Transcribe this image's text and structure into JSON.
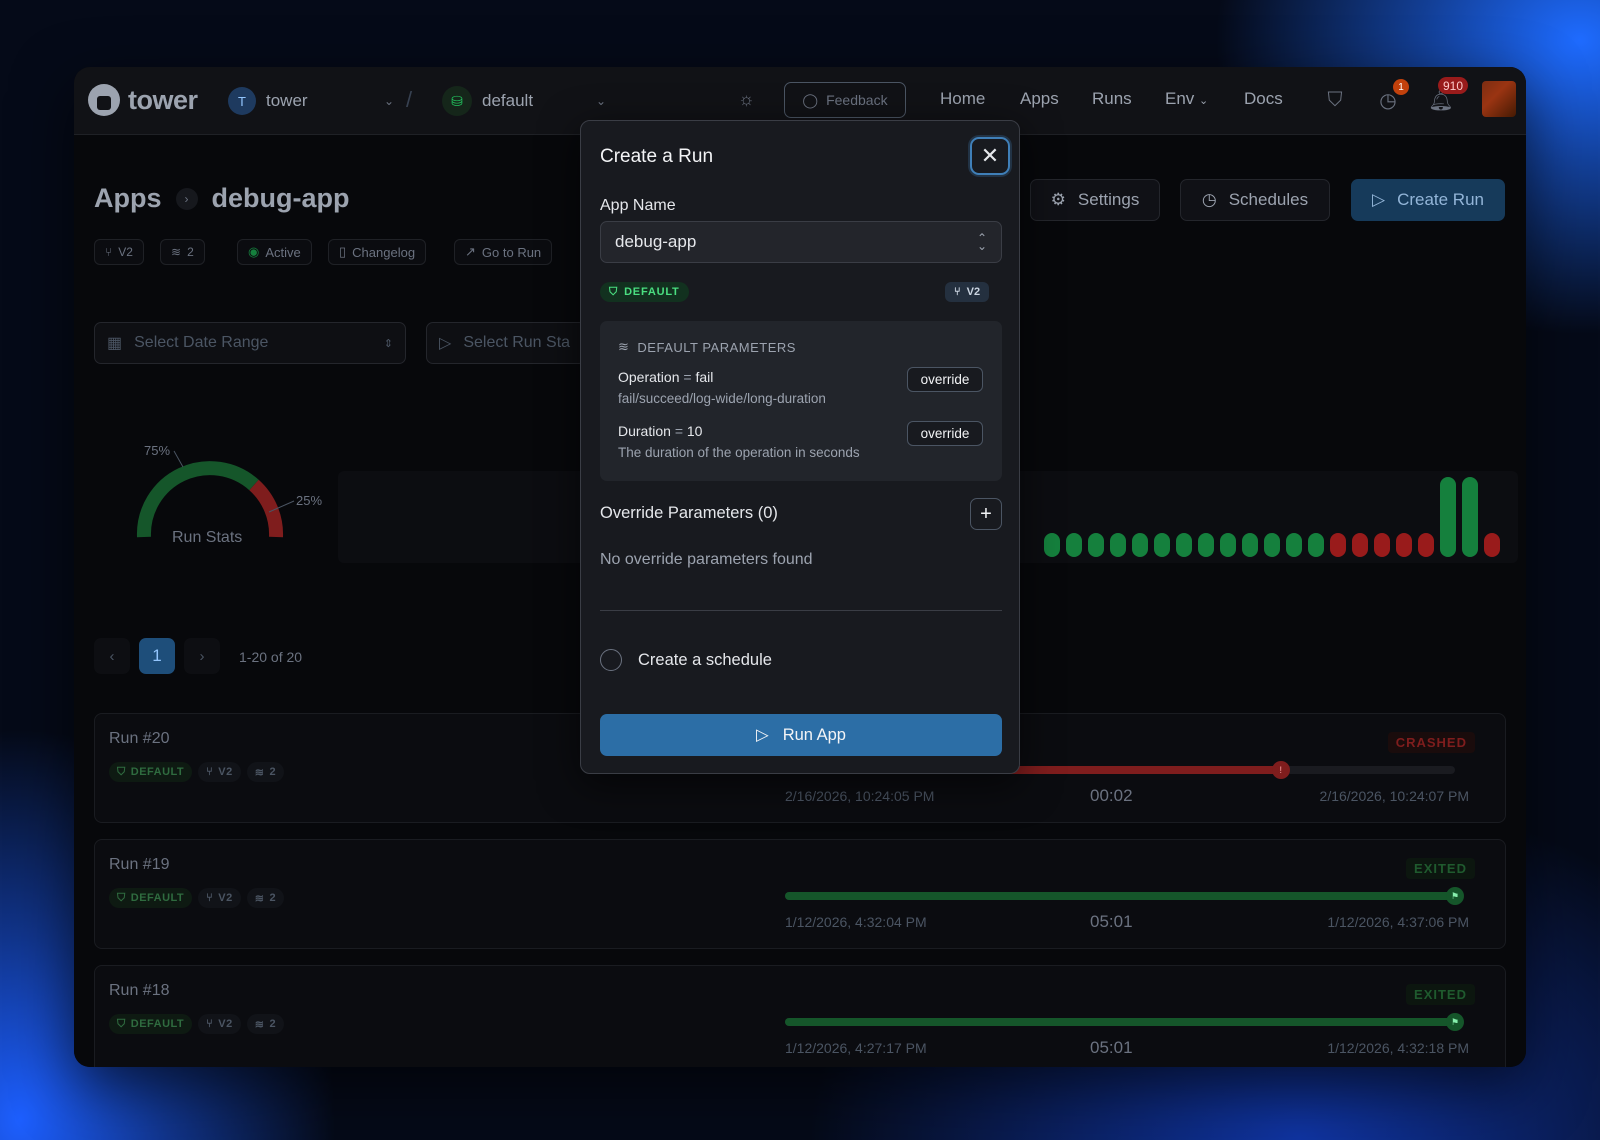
{
  "brand": {
    "name": "tower"
  },
  "team": {
    "initial": "T",
    "name": "tower"
  },
  "environment": {
    "name": "default"
  },
  "topbar": {
    "feedback_label": "Feedback",
    "nav": [
      "Home",
      "Apps",
      "Runs",
      "Env",
      "Docs"
    ],
    "alerts_badge": "1",
    "notifications_count": "910"
  },
  "breadcrumb": {
    "root": "Apps",
    "current": "debug-app"
  },
  "app_meta": {
    "version": "V2",
    "param_count": "2",
    "status": "Active",
    "changelog": "Changelog",
    "go_to_run": "Go to Run"
  },
  "header_actions": {
    "settings": "Settings",
    "schedules": "Schedules",
    "create_run": "Create Run"
  },
  "filters": {
    "date_range_placeholder": "Select Date Range",
    "run_status_placeholder": "Select Run Sta"
  },
  "stats": {
    "gauge_label": "Run Stats",
    "success_pct_label": "75%",
    "fail_pct_label": "25%",
    "success_fraction": 0.75,
    "recent_runs": [
      "success",
      "success",
      "success",
      "success",
      "success",
      "success",
      "success",
      "success",
      "success",
      "success",
      "success",
      "success",
      "success",
      "failed",
      "failed",
      "failed",
      "failed",
      "failed",
      "success-long",
      "success-long",
      "failed"
    ],
    "colors": {
      "success": "#15803d",
      "failed": "#991b1b"
    }
  },
  "pagination": {
    "current_page": "1",
    "range": "1-20 of 20"
  },
  "runs": [
    {
      "title": "Run #20",
      "env": "DEFAULT",
      "version": "V2",
      "params": "2",
      "status": "CRASHED",
      "start": "2/16/2026, 10:24:05 PM",
      "duration": "00:02",
      "end": "2/16/2026, 10:24:07 PM",
      "progress": 0.74
    },
    {
      "title": "Run #19",
      "env": "DEFAULT",
      "version": "V2",
      "params": "2",
      "status": "EXITED",
      "start": "1/12/2026, 4:32:04 PM",
      "duration": "05:01",
      "end": "1/12/2026, 4:37:06 PM",
      "progress": 1.0
    },
    {
      "title": "Run #18",
      "env": "DEFAULT",
      "version": "V2",
      "params": "2",
      "status": "EXITED",
      "start": "1/12/2026, 4:27:17 PM",
      "duration": "05:01",
      "end": "1/12/2026, 4:32:18 PM",
      "progress": 1.0
    }
  ],
  "modal": {
    "title": "Create a Run",
    "app_name_label": "App Name",
    "app_name_value": "debug-app",
    "env_badge": "DEFAULT",
    "version_badge": "V2",
    "default_params_heading": "DEFAULT PARAMETERS",
    "params": [
      {
        "name": "Operation",
        "value": "fail",
        "description": "fail/succeed/log-wide/long-duration",
        "override_label": "override"
      },
      {
        "name": "Duration",
        "value": "10",
        "description": "The duration of the operation in seconds",
        "override_label": "override"
      }
    ],
    "override_heading": "Override Parameters (0)",
    "no_overrides": "No override parameters found",
    "schedule_label": "Create a schedule",
    "run_button": "Run App"
  }
}
